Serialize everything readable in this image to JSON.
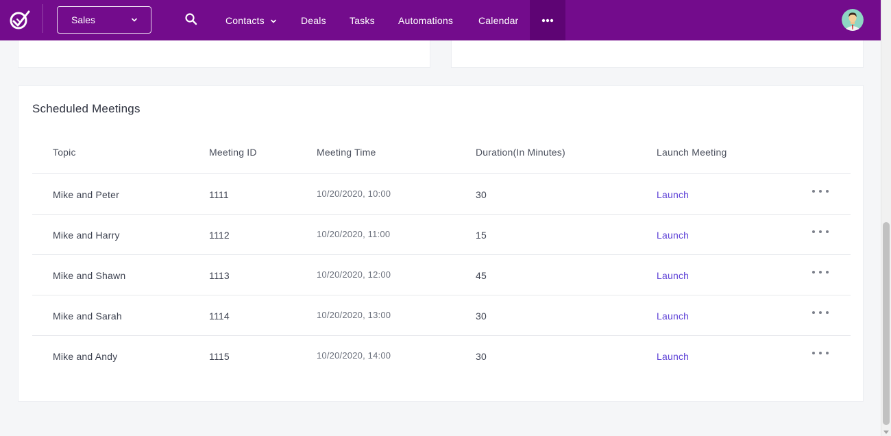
{
  "nav": {
    "pipeline": "Sales",
    "items": [
      {
        "label": "Contacts"
      },
      {
        "label": "Deals"
      },
      {
        "label": "Tasks"
      },
      {
        "label": "Automations"
      },
      {
        "label": "Calendar"
      }
    ],
    "colors": {
      "bar": "#730c8c",
      "more_active": "#5e0474"
    },
    "icons": [
      "app-logo-icon",
      "chevron-down-icon",
      "search-icon",
      "more-horizontal-icon",
      "user-avatar-icon"
    ]
  },
  "meetings": {
    "title": "Scheduled Meetings",
    "columns": [
      "Topic",
      "Meeting ID",
      "Meeting Time",
      "Duration(In Minutes)",
      "Launch Meeting"
    ],
    "rows": [
      {
        "topic": "Mike and Peter",
        "id": "1111",
        "time": "10/20/2020, 10:00",
        "duration": "30",
        "launch": "Launch"
      },
      {
        "topic": "Mike and Harry",
        "id": "1112",
        "time": "10/20/2020, 11:00",
        "duration": "15",
        "launch": "Launch"
      },
      {
        "topic": "Mike and Shawn",
        "id": "1113",
        "time": "10/20/2020, 12:00",
        "duration": "45",
        "launch": "Launch"
      },
      {
        "topic": "Mike and Sarah",
        "id": "1114",
        "time": "10/20/2020, 13:00",
        "duration": "30",
        "launch": "Launch"
      },
      {
        "topic": "Mike and Andy",
        "id": "1115",
        "time": "10/20/2020, 14:00",
        "duration": "30",
        "launch": "Launch"
      }
    ],
    "link_color": "#5b3fd6"
  }
}
